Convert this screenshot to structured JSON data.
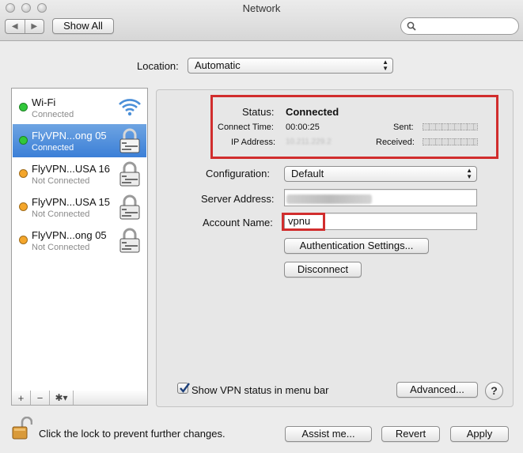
{
  "window": {
    "title": "Network",
    "show_all": "Show All",
    "search_placeholder": ""
  },
  "location": {
    "label": "Location:",
    "value": "Automatic"
  },
  "sidebar": {
    "items": [
      {
        "name": "Wi-Fi",
        "status": "Connected",
        "dot_color": "#31c83a",
        "icon": "wifi-icon",
        "selected": false
      },
      {
        "name": "FlyVPN...ong 05",
        "status": "Connected",
        "dot_color": "#31c83a",
        "icon": "lock-icon",
        "selected": true
      },
      {
        "name": "FlyVPN...USA 16",
        "status": "Not Connected",
        "dot_color": "#f4a62b",
        "icon": "lock-icon",
        "selected": false
      },
      {
        "name": "FlyVPN...USA 15",
        "status": "Not Connected",
        "dot_color": "#f4a62b",
        "icon": "lock-icon",
        "selected": false
      },
      {
        "name": "FlyVPN...ong 05",
        "status": "Not Connected",
        "dot_color": "#f4a62b",
        "icon": "lock-icon",
        "selected": false
      }
    ],
    "footer": {
      "add": "+",
      "remove": "−",
      "gear": "✱▾"
    }
  },
  "status": {
    "status_label": "Status:",
    "status_value": "Connected",
    "connect_time_label": "Connect Time:",
    "connect_time_value": "00:00:25",
    "ip_label": "IP Address:",
    "ip_value": "10.211.229.2",
    "sent_label": "Sent:",
    "received_label": "Received:"
  },
  "form": {
    "configuration_label": "Configuration:",
    "configuration_value": "Default",
    "server_label": "Server Address:",
    "server_value": "",
    "account_label": "Account Name:",
    "account_value": "vpnu",
    "auth_button": "Authentication Settings...",
    "disconnect_button": "Disconnect"
  },
  "bottom": {
    "show_vpn_status": "Show VPN status in menu bar",
    "show_vpn_checked": true,
    "advanced_button": "Advanced...",
    "help": "?",
    "lock_text": "Click the lock to prevent further changes.",
    "assist_button": "Assist me...",
    "revert_button": "Revert",
    "apply_button": "Apply"
  },
  "colors": {
    "highlight_box": "#d12d2d",
    "selection": "#3b7fd7"
  }
}
